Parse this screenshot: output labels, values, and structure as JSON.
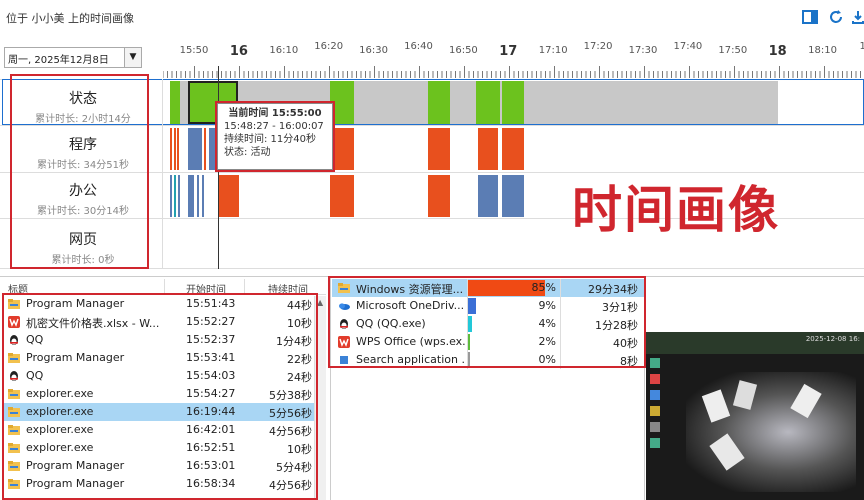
{
  "window": {
    "title": "位于 小小美 上的时间画像"
  },
  "toolbar_icons": [
    "panel-icon",
    "refresh-icon",
    "export-icon"
  ],
  "date_selector": {
    "value": "周一, 2025年12月8日"
  },
  "timeline": {
    "ticks": [
      "15:50",
      "16",
      "16:10",
      "16:20",
      "16:30",
      "16:40",
      "16:50",
      "17",
      "17:10",
      "17:20",
      "17:30",
      "17:40",
      "17:50",
      "18",
      "18:10",
      "18:"
    ],
    "rows": [
      {
        "name": "状态",
        "duration": "累计时长: 2小时14分"
      },
      {
        "name": "程序",
        "duration": "累计时长: 34分51秒"
      },
      {
        "name": "办公",
        "duration": "累计时长: 30分14秒"
      },
      {
        "name": "网页",
        "duration": "累计时长: 0秒"
      }
    ],
    "tooltip": {
      "line1": "当前时间 15:55:00",
      "line2": "15:48:27 - 16:00:07",
      "line3": "持续时间: 11分40秒",
      "line4": "状态: 活动"
    },
    "colors": {
      "active": "#6cc21e",
      "idle": "#c8c8c8",
      "program": "#e8501e",
      "blue": "#5b7db4",
      "cursor": "#333333"
    }
  },
  "overlay_title": "时间画像",
  "process_list": {
    "headers": {
      "title": "标题",
      "start": "开始时间",
      "duration": "持续时间"
    },
    "rows": [
      {
        "icon": "folder-icon",
        "name": "Program Manager",
        "start": "15:51:43",
        "duration": "44秒"
      },
      {
        "icon": "wps-icon",
        "name": "机密文件价格表.xlsx - W...",
        "start": "15:52:27",
        "duration": "10秒"
      },
      {
        "icon": "qq-icon",
        "name": "QQ",
        "start": "15:52:37",
        "duration": "1分4秒"
      },
      {
        "icon": "folder-icon",
        "name": "Program Manager",
        "start": "15:53:41",
        "duration": "22秒"
      },
      {
        "icon": "qq-icon",
        "name": "QQ",
        "start": "15:54:03",
        "duration": "24秒"
      },
      {
        "icon": "folder-icon",
        "name": "explorer.exe",
        "start": "15:54:27",
        "duration": "5分38秒"
      },
      {
        "icon": "folder-icon",
        "name": "explorer.exe",
        "start": "16:19:44",
        "duration": "5分56秒",
        "selected": true
      },
      {
        "icon": "folder-icon",
        "name": "explorer.exe",
        "start": "16:42:01",
        "duration": "4分56秒"
      },
      {
        "icon": "folder-icon",
        "name": "explorer.exe",
        "start": "16:52:51",
        "duration": "10秒"
      },
      {
        "icon": "folder-icon",
        "name": "Program Manager",
        "start": "16:53:01",
        "duration": "5分4秒"
      },
      {
        "icon": "folder-icon",
        "name": "Program Manager",
        "start": "16:58:34",
        "duration": "4分56秒"
      }
    ]
  },
  "stats": [
    {
      "icon": "folder-icon",
      "name": "Windows 资源管理...",
      "percent": "85%",
      "share": 0.85,
      "duration": "29分34秒",
      "color": "#f04a14"
    },
    {
      "icon": "onedrive-icon",
      "name": "Microsoft OneDriv...",
      "percent": "9%",
      "share": 0.09,
      "duration": "3分1秒",
      "color": "#3b6fd6"
    },
    {
      "icon": "qq-icon",
      "name": "QQ (QQ.exe)",
      "percent": "4%",
      "share": 0.04,
      "duration": "1分28秒",
      "color": "#22c8d8"
    },
    {
      "icon": "wps-icon",
      "name": "WPS Office (wps.ex...",
      "percent": "2%",
      "share": 0.02,
      "duration": "40秒",
      "color": "#5dbb3c"
    },
    {
      "icon": "search-icon",
      "name": "Search application ...",
      "percent": "0%",
      "share": 0.0,
      "duration": "8秒",
      "color": "#999999"
    }
  ],
  "screenshot_thumb": {
    "timestamp": "2025-12-08 16:"
  }
}
